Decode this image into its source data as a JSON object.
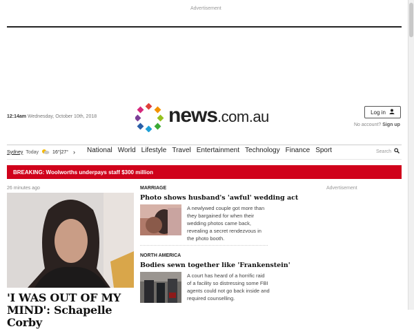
{
  "ads": {
    "top_label": "Advertisement",
    "side_label": "Advertisement"
  },
  "header": {
    "time": "12:1",
    "time_suffix": "4am",
    "date": "Wednesday, October 10th, 2018",
    "logo_main": "news",
    "logo_suffix": ".com.au",
    "login_label": "Log in",
    "no_account": "No account?",
    "sign_up": "Sign up"
  },
  "weather": {
    "city": "Sydney",
    "day": "Today",
    "temps": "16°|27°"
  },
  "nav": {
    "items": [
      "National",
      "World",
      "Lifestyle",
      "Travel",
      "Entertainment",
      "Technology",
      "Finance",
      "Sport"
    ],
    "search_label": "Search"
  },
  "breaking": {
    "text": "BREAKING: Woolworths underpays staff $300 million"
  },
  "hero": {
    "time_ago": "26 minutes ago",
    "headline_line1": "'I WAS OUT OF MY",
    "headline_line2": "MIND': Schapelle Corby"
  },
  "stories": [
    {
      "section": "MARRIAGE",
      "title": "Photo shows husband's 'awful' wedding act",
      "summary": "A newlywed couple got more than they bargained for when their wedding photos came back, revealing a secret rendezvous in the photo booth."
    },
    {
      "section": "NORTH AMERICA",
      "title": "Bodies sewn together like 'Frankenstein'",
      "summary": "A court has heard of a horrific raid of a facility so distressing some FBI agents could not go back inside and required counselling."
    }
  ],
  "colors": {
    "breaking_red": "#d0021b",
    "text_dark": "#222222"
  }
}
